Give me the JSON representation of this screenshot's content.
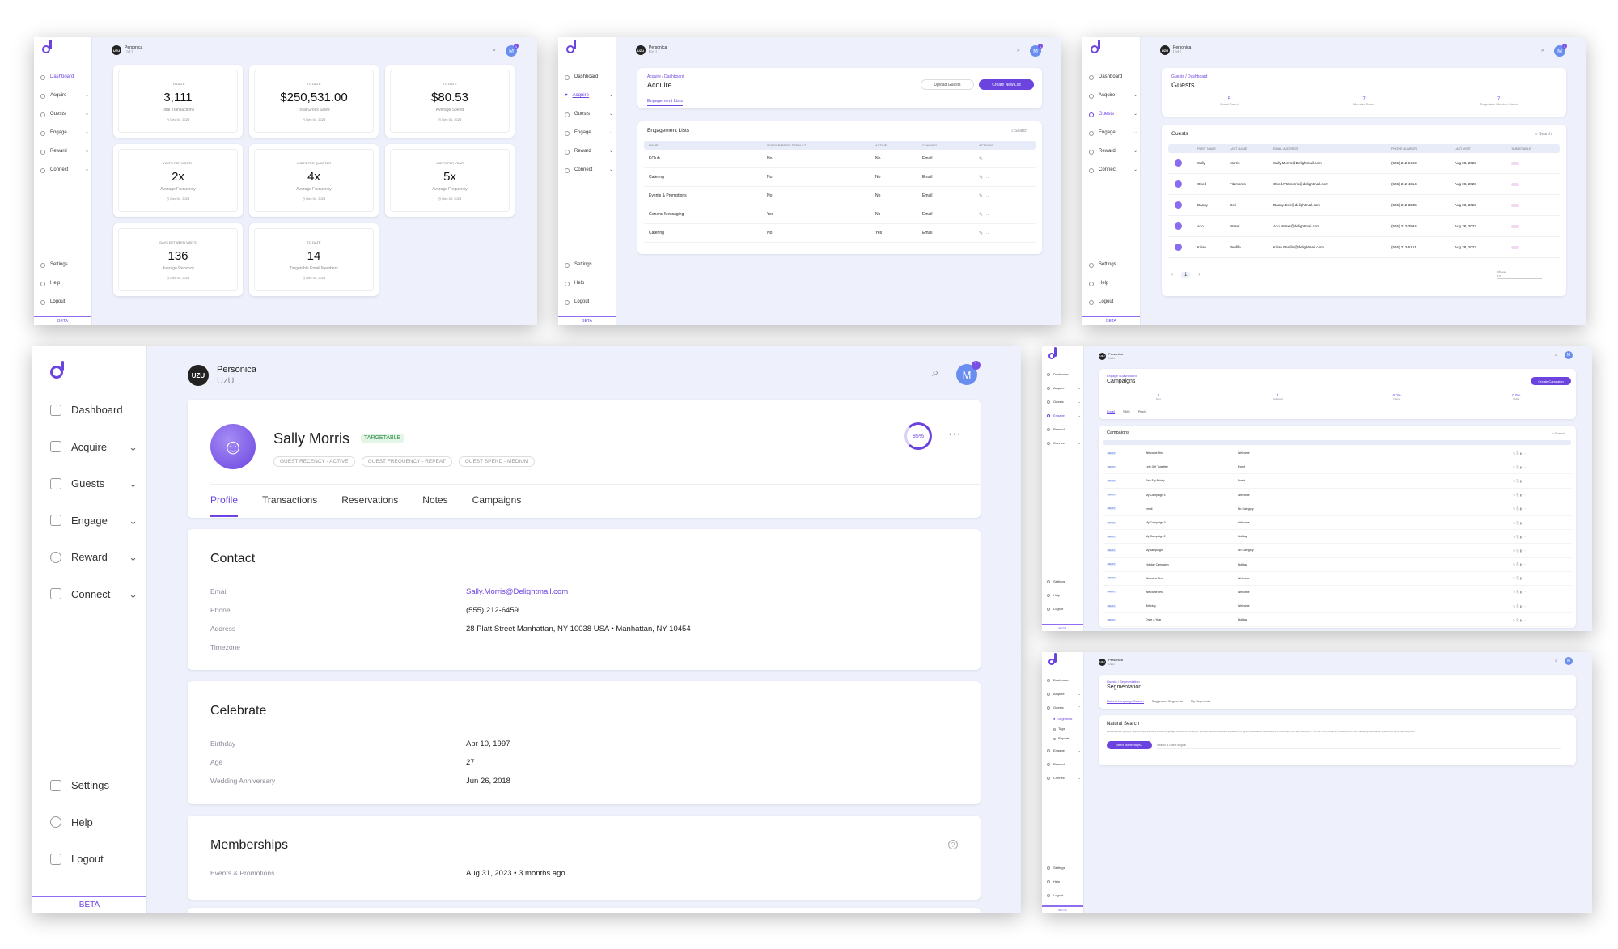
{
  "brand": {
    "name": "Personica",
    "sub": "UzU",
    "avatar_initial": "M",
    "notif_count": "1",
    "beta": "BETA",
    "uzu": "UZU"
  },
  "nav": {
    "dashboard": "Dashboard",
    "acquire": "Acquire",
    "guests": "Guests",
    "engage": "Engage",
    "reward": "Reward",
    "connect": "Connect",
    "settings": "Settings",
    "help": "Help",
    "logout": "Logout",
    "segments": "Segments",
    "tags": "Tags",
    "reports": "Reports"
  },
  "dashboard": {
    "cards": [
      {
        "top": "TO DATE",
        "value": "3,111",
        "label": "Total Transactions",
        "date": "Dec 04, 2023"
      },
      {
        "top": "TO DATE",
        "value": "$250,531.00",
        "label": "Total Gross Sales",
        "date": "Dec 04, 2023"
      },
      {
        "top": "TO DATE",
        "value": "$80.53",
        "label": "Average Spend",
        "date": "Dec 04, 2023"
      },
      {
        "top": "VISITS PER MONTH",
        "value": "2x",
        "label": "Average Frequency",
        "date": "Dec 04, 2023"
      },
      {
        "top": "VISITS PER QUARTER",
        "value": "4x",
        "label": "Average Frequency",
        "date": "Dec 04, 2023"
      },
      {
        "top": "VISITS PER YEAR",
        "value": "5x",
        "label": "Average Frequency",
        "date": "Dec 04, 2023"
      },
      {
        "top": "DAYS BETWEEN VISITS",
        "value": "136",
        "label": "Average Recency",
        "date": "Dec 04, 2023"
      },
      {
        "top": "TO DATE",
        "value": "14",
        "label": "Targetable Email Members",
        "date": "Dec 04, 2023"
      }
    ]
  },
  "acquire": {
    "crumb": "Acquire / Dashboard",
    "title": "Acquire",
    "upload": "Upload Guests",
    "create": "Create New List",
    "tab": "Engagement Lists",
    "list_title": "Engagement Lists",
    "search": "Search",
    "headers": [
      "NAME",
      "SUBSCRIBE BY DEFAULT",
      "ACTIVE",
      "CHANNEL",
      "ACTIONS"
    ],
    "rows": [
      [
        "EClub",
        "No",
        "No",
        "Email"
      ],
      [
        "Catering",
        "No",
        "No",
        "Email"
      ],
      [
        "Events & Promotions",
        "No",
        "No",
        "Email"
      ],
      [
        "General Messaging",
        "Yes",
        "No",
        "Email"
      ],
      [
        "Catering",
        "No",
        "Yes",
        "Email"
      ]
    ]
  },
  "guests": {
    "crumb": "Guests / Dashboard",
    "title": "Guests",
    "stats": [
      {
        "v": "5",
        "l": "Guest Count"
      },
      {
        "v": "7",
        "l": "Member Count"
      },
      {
        "v": "7",
        "l": "Targetable Member Count"
      }
    ],
    "list_title": "Guests",
    "search": "Search",
    "headers": [
      "FIRST NAME",
      "LAST NAME",
      "EMAIL ADDRESS",
      "PHONE NUMBER",
      "LAST VISIT",
      "TARGETABLE"
    ],
    "rows": [
      [
        "Sally",
        "Morris",
        "Sally.Morris@Delightmail.com",
        "(555) 212-6459",
        "Aug 28, 2023"
      ],
      [
        "Obed",
        "Fitzmorris",
        "Obed.Fitzmorris@delightmail.com",
        "(555) 212-4314",
        "Aug 28, 2023"
      ],
      [
        "Danny",
        "Dori",
        "Danny.Dori@delightmail.com",
        "(555) 212-3245",
        "Aug 28, 2023"
      ],
      [
        "Azo",
        "Wasel",
        "Azo.Wasel@delightmail.com",
        "(555) 212-3934",
        "Aug 28, 2023"
      ],
      [
        "Kilian",
        "Penfile",
        "Kilian.Penfile@delightmail.com",
        "(555) 212-5161",
        "Aug 28, 2023"
      ]
    ],
    "page": "1",
    "show": "Show",
    "show_val": "24"
  },
  "profile": {
    "name": "Sally Morris",
    "badge": "TARGETABLE",
    "tags": [
      "GUEST RECENCY - ACTIVE",
      "GUEST FREQUENCY - REPEAT",
      "GUEST SPEND - MEDIUM"
    ],
    "score": "85%",
    "tabs": [
      "Profile",
      "Transactions",
      "Reservations",
      "Notes",
      "Campaigns"
    ],
    "contact": {
      "title": "Contact",
      "email_l": "Email",
      "email": "Sally.Morris@Delightmail.com",
      "phone_l": "Phone",
      "phone": "(555) 212-6459",
      "address_l": "Address",
      "address": "28 Platt Street Manhattan, NY 10038 USA • Manhattan, NY 10454",
      "tz_l": "Timezone"
    },
    "celebrate": {
      "title": "Celebrate",
      "bday_l": "Birthday",
      "bday": "Apr 10, 1997",
      "age_l": "Age",
      "age": "27",
      "wed_l": "Wedding Anniversary",
      "wed": "Jun 26, 2018"
    },
    "memberships": {
      "title": "Memberships",
      "row_l": "Events & Promotions",
      "row": "Aug 31, 2023 • 3 months ago"
    }
  },
  "campaigns": {
    "crumb": "Engage / Dashboard",
    "title": "Campaigns",
    "create": "Create Campaign",
    "stats": [
      {
        "v": "3",
        "l": "Sent"
      },
      {
        "v": "4",
        "l": "Delivered"
      },
      {
        "v": "0.0%",
        "l": "Opens"
      },
      {
        "v": "0.0%",
        "l": "Clicks"
      }
    ],
    "tabs": [
      "Email",
      "SMS",
      "Push"
    ],
    "list_title": "Campaigns",
    "search": "Search",
    "rows": [
      [
        "Welcome Test",
        "Welcome"
      ],
      [
        "Lets Get Together",
        "Event"
      ],
      [
        "Fish Fry Friday",
        "Event"
      ],
      [
        "My Campaign 4",
        "Welcome"
      ],
      [
        "email",
        "No Category"
      ],
      [
        "My Campaign 3",
        "Welcome"
      ],
      [
        "My Campaign 2",
        "Holiday"
      ],
      [
        "My campaign",
        "No Category"
      ],
      [
        "Holiday Campaign",
        "Holiday"
      ],
      [
        "Welcome Test",
        "Welcome"
      ],
      [
        "Welcome Test",
        "Welcome"
      ],
      [
        "Birthday",
        "Welcome"
      ],
      [
        "Once a Year",
        "Holiday"
      ]
    ],
    "status": "DRAFT"
  },
  "segmentation": {
    "crumb": "Guests / Segmentation",
    "title": "Segmentation",
    "tabs": [
      "Natural Language Search",
      "Suggested Segments",
      "My Segments"
    ],
    "card_title": "Natural Search",
    "desc": "Find a specific group of guests using standard spoken language criteria. For example, you can ask the database a question or type in a sentence describing the information you are looking for. You can then create an Audience for your marketing automation platform to push your segment.",
    "btn": "Select search steps",
    "placeholder": "Search a Guest or goal"
  }
}
